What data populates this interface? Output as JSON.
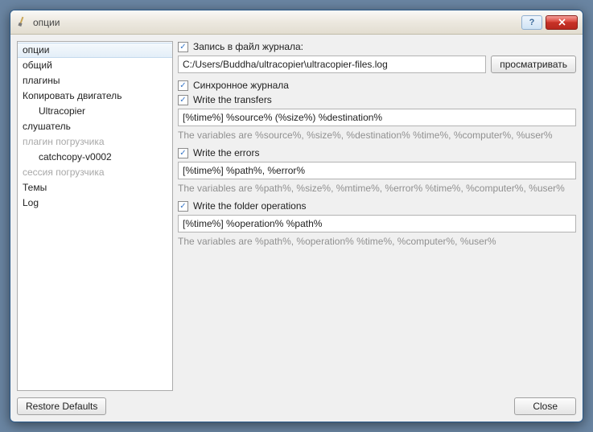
{
  "window": {
    "title": "опции"
  },
  "titlebar": {
    "help": "?",
    "close": "✕"
  },
  "sidebar": {
    "items": [
      {
        "label": "опции",
        "selected": true
      },
      {
        "label": "общий"
      },
      {
        "label": "плагины"
      },
      {
        "label": "Копировать двигатель"
      },
      {
        "label": "Ultracopier",
        "child": true
      },
      {
        "label": "слушатель"
      },
      {
        "label": "плагин погрузчика",
        "muted": true
      },
      {
        "label": "catchcopy-v0002",
        "child": true
      },
      {
        "label": "сессия погрузчика",
        "muted": true
      },
      {
        "label": "Темы"
      },
      {
        "label": "Log"
      }
    ]
  },
  "log": {
    "write_log_label": "Запись в файл журнала:",
    "path": "C:/Users/Buddha/ultracopier\\ultracopier-files.log",
    "browse": "просматривать",
    "sync_label": "Синхронное журнала",
    "write_transfers_label": "Write the transfers",
    "transfers_format": "[%time%] %source% (%size%) %destination%",
    "transfers_hint": "The variables are %source%, %size%, %destination% %time%, %computer%, %user%",
    "write_errors_label": "Write the errors",
    "errors_format": "[%time%] %path%, %error%",
    "errors_hint": "The variables are %path%, %size%, %mtime%, %error% %time%, %computer%, %user%",
    "write_folder_label": "Write the folder operations",
    "folder_format": "[%time%] %operation% %path%",
    "folder_hint": "The variables are %path%, %operation% %time%, %computer%, %user%"
  },
  "footer": {
    "restore": "Restore Defaults",
    "close": "Close"
  }
}
